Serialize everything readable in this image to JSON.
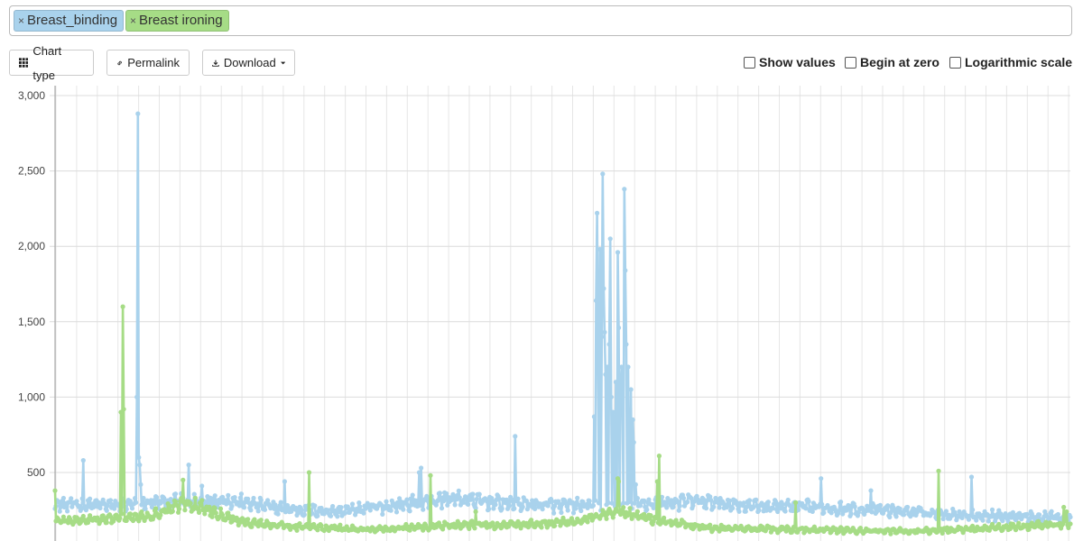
{
  "tags": [
    {
      "label": "Breast_binding",
      "remove": "×",
      "color": "#a9d2ec"
    },
    {
      "label": "Breast ironing",
      "remove": "×",
      "color": "#a6dc86"
    }
  ],
  "toolbar": {
    "chart_type_label": "Chart type",
    "permalink_label": "Permalink",
    "download_label": "Download"
  },
  "options": {
    "show_values_label": "Show values",
    "begin_at_zero_label": "Begin at zero",
    "log_scale_label": "Logarithmic scale",
    "show_values_checked": false,
    "begin_at_zero_checked": false,
    "log_scale_checked": false
  },
  "chart_data": {
    "type": "line",
    "title": "",
    "xlabel": "",
    "ylabel": "",
    "ylim": [
      0,
      3000
    ],
    "yticks": [
      500,
      1000,
      1500,
      2000,
      2500,
      3000
    ],
    "ytick_labels": [
      "500",
      "1,000",
      "1,500",
      "2,000",
      "2,500",
      "3,000"
    ],
    "grid": true,
    "num_days": 1080,
    "series": [
      {
        "name": "Breast_binding",
        "color": "#a9d2ec",
        "baseline": [
          [
            0,
            290
          ],
          [
            80,
            280
          ],
          [
            100,
            300
          ],
          [
            180,
            320
          ],
          [
            240,
            260
          ],
          [
            300,
            240
          ],
          [
            360,
            280
          ],
          [
            420,
            330
          ],
          [
            470,
            300
          ],
          [
            540,
            280
          ],
          [
            620,
            290
          ],
          [
            680,
            310
          ],
          [
            740,
            280
          ],
          [
            800,
            270
          ],
          [
            880,
            250
          ],
          [
            960,
            220
          ],
          [
            1080,
            200
          ]
        ],
        "spikes": [
          [
            30,
            580
          ],
          [
            87,
            1000
          ],
          [
            88,
            2880
          ],
          [
            89,
            600
          ],
          [
            90,
            550
          ],
          [
            91,
            420
          ],
          [
            142,
            550
          ],
          [
            156,
            410
          ],
          [
            244,
            440
          ],
          [
            387,
            500
          ],
          [
            389,
            530
          ],
          [
            489,
            740
          ],
          [
            573,
            870
          ],
          [
            575,
            1640
          ],
          [
            576,
            2220
          ],
          [
            577,
            1290
          ],
          [
            579,
            1980
          ],
          [
            581,
            1400
          ],
          [
            582,
            2480
          ],
          [
            583,
            1720
          ],
          [
            584,
            1430
          ],
          [
            585,
            1150
          ],
          [
            587,
            1200
          ],
          [
            589,
            1350
          ],
          [
            590,
            2050
          ],
          [
            591,
            1000
          ],
          [
            593,
            900
          ],
          [
            594,
            820
          ],
          [
            596,
            1100
          ],
          [
            598,
            1960
          ],
          [
            599,
            1460
          ],
          [
            601,
            1050
          ],
          [
            602,
            1200
          ],
          [
            603,
            1080
          ],
          [
            605,
            2380
          ],
          [
            606,
            1840
          ],
          [
            607,
            1350
          ],
          [
            609,
            1200
          ],
          [
            612,
            1050
          ],
          [
            614,
            850
          ],
          [
            615,
            700
          ],
          [
            617,
            420
          ],
          [
            814,
            460
          ],
          [
            867,
            380
          ],
          [
            974,
            470
          ]
        ]
      },
      {
        "name": "Breast ironing",
        "color": "#a6dc86",
        "baseline": [
          [
            0,
            180
          ],
          [
            60,
            190
          ],
          [
            100,
            210
          ],
          [
            140,
            300
          ],
          [
            170,
            240
          ],
          [
            200,
            170
          ],
          [
            260,
            140
          ],
          [
            340,
            120
          ],
          [
            420,
            150
          ],
          [
            470,
            150
          ],
          [
            520,
            160
          ],
          [
            560,
            180
          ],
          [
            600,
            240
          ],
          [
            640,
            180
          ],
          [
            700,
            130
          ],
          [
            800,
            120
          ],
          [
            900,
            110
          ],
          [
            960,
            120
          ],
          [
            1080,
            160
          ]
        ],
        "spikes": [
          [
            0,
            380
          ],
          [
            70,
            900
          ],
          [
            72,
            1600
          ],
          [
            73,
            920
          ],
          [
            136,
            450
          ],
          [
            270,
            500
          ],
          [
            399,
            480
          ],
          [
            447,
            240
          ],
          [
            598,
            460
          ],
          [
            599,
            440
          ],
          [
            640,
            440
          ],
          [
            642,
            610
          ],
          [
            787,
            300
          ],
          [
            939,
            510
          ],
          [
            1072,
            270
          ],
          [
            1075,
            240
          ]
        ]
      }
    ]
  }
}
